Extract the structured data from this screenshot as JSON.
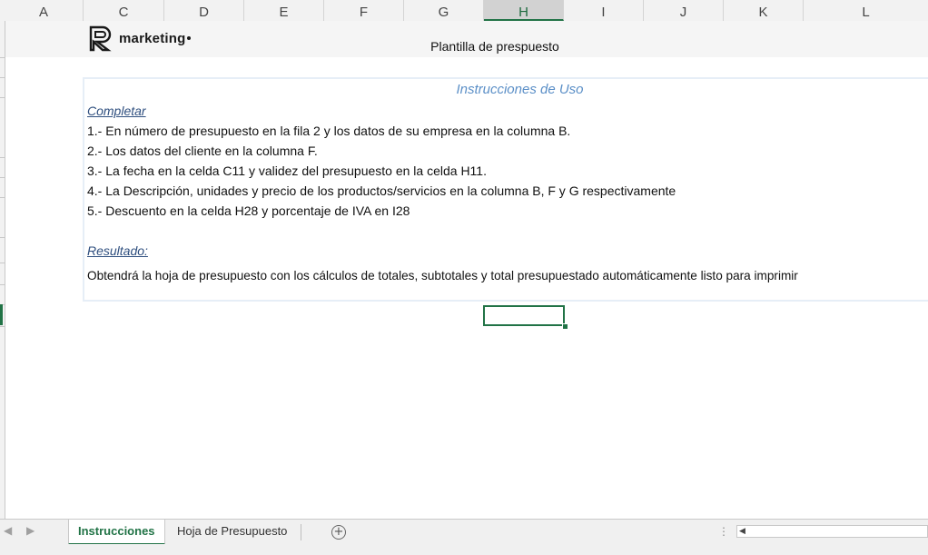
{
  "columns": [
    {
      "label": "A"
    },
    {
      "label": "C"
    },
    {
      "label": "D"
    },
    {
      "label": "E"
    },
    {
      "label": "F"
    },
    {
      "label": "G"
    },
    {
      "label": "H",
      "selected": true
    },
    {
      "label": "I"
    },
    {
      "label": "J"
    },
    {
      "label": "K"
    },
    {
      "label": "L"
    }
  ],
  "header": {
    "logo_text": "marketing",
    "page_title": "Plantilla de prespuesto"
  },
  "instructions": {
    "title": "Instrucciones de Uso",
    "complete_heading": "Completar",
    "steps": [
      "1.- En número de presupuesto en la fila 2 y los datos de su empresa en la columna B.",
      "2.- Los datos del cliente en la columna  F.",
      "3.- La fecha en la celda C11 y validez del presupuesto en la celda H11.",
      "4.- La Descripción, unidades y precio de los productos/servicios en la columna B, F y G respectivamente",
      "5.- Descuento en la celda H28  y porcentaje de IVA en I28"
    ],
    "result_heading": "Resultado:",
    "result_text": "Obtendrá la hoja de presupuesto con los cálculos de totales, subtotales y total presupuestado automáticamente listo para imprimir"
  },
  "tabs": {
    "items": [
      {
        "label": "Instrucciones",
        "active": true
      },
      {
        "label": "Hoja de Presupuesto",
        "active": false
      }
    ],
    "add_icon": "plus-circle-icon"
  },
  "colors": {
    "accent": "#217346",
    "title_blue": "#5b8fc7",
    "heading_blue": "#2f4f7f"
  }
}
